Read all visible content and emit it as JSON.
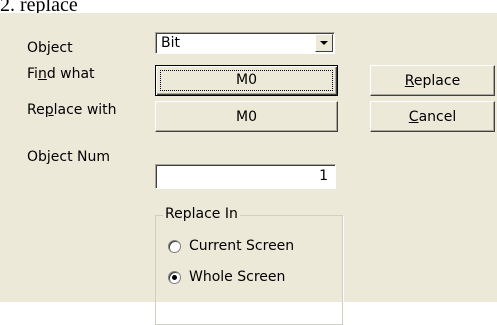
{
  "heading": "2.    replace",
  "labels": {
    "object": "Object",
    "find_what_pre": "Fi",
    "find_what_key": "n",
    "find_what_post": "d what",
    "replace_with_pre": "Re",
    "replace_with_key": "p",
    "replace_with_post": "lace with",
    "object_num": "Object Num"
  },
  "fields": {
    "object_value": "Bit",
    "find_what_value": "M0",
    "replace_with_value": "M0",
    "object_num_value": "1"
  },
  "buttons": {
    "replace_key": "R",
    "replace_rest": "eplace",
    "cancel_key": "C",
    "cancel_rest": "ancel"
  },
  "replace_in": {
    "title": "Replace In",
    "options": [
      {
        "label": "Current Screen",
        "checked": false
      },
      {
        "label": "Whole Screen",
        "checked": true
      }
    ]
  }
}
